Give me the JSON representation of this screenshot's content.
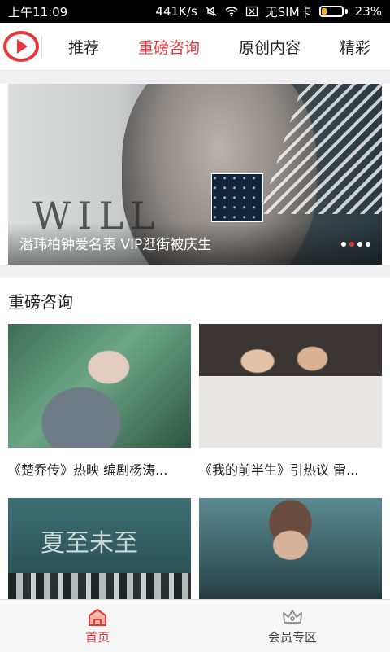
{
  "status_bar": {
    "time": "上午11:09",
    "speed": "441K/s",
    "sim": "无SIM卡",
    "battery": "23%",
    "battery_level": 0.23
  },
  "nav": {
    "tabs": [
      {
        "label": "推荐",
        "active": false
      },
      {
        "label": "重磅咨询",
        "active": true
      },
      {
        "label": "原创内容",
        "active": false
      },
      {
        "label": "精彩",
        "active": false
      }
    ]
  },
  "banner": {
    "caption": "潘玮柏钟爱名表 VIP逛街被庆生",
    "page_count": 4,
    "active_index": 1,
    "art_text": "WILL"
  },
  "section": {
    "title": "重磅咨询"
  },
  "articles": [
    {
      "title": "《楚乔传》热映 编剧杨涛..."
    },
    {
      "title": "《我的前半生》引热议 雷..."
    },
    {
      "title": ""
    },
    {
      "title": ""
    }
  ],
  "poster_text": "夏至未至",
  "bottom_nav": {
    "items": [
      {
        "label": "首页",
        "icon": "home-icon",
        "active": true
      },
      {
        "label": "会员专区",
        "icon": "crown-icon",
        "active": false
      }
    ]
  },
  "colors": {
    "accent": "#e8363a",
    "background": "#ffffff",
    "band": "#f1f1f4"
  }
}
